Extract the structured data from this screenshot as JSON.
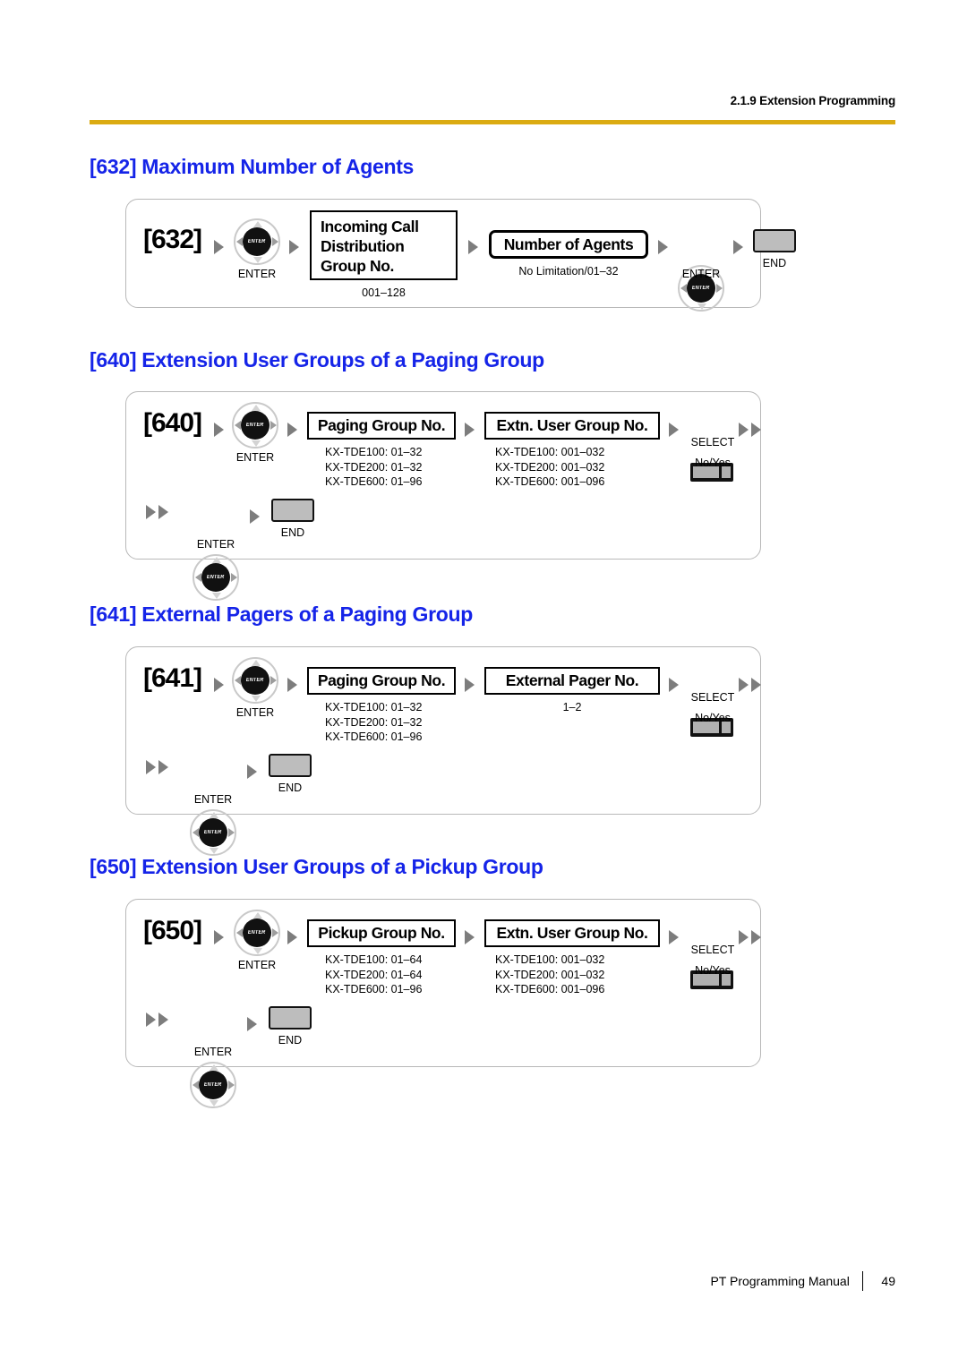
{
  "header": {
    "running_head": "2.1.9 Extension Programming",
    "rule_color": "#dbab12"
  },
  "heading_color": "#1524e8",
  "sections": [
    {
      "heading": "[632] Maximum Number of Agents",
      "prog_code": "[632]",
      "enter_label_1": "ENTER",
      "enter_label_2": "ENTER",
      "box1_line1": "Incoming Call",
      "box1_line2": "Distribution",
      "box1_line3": "Group No.",
      "box1_range": "001–128",
      "box2_label": "Number of Agents",
      "box2_range": "No Limitation/01–32",
      "end_label": "END"
    },
    {
      "heading": "[640] Extension User Groups of a Paging Group",
      "prog_code": "[640]",
      "enter_label_1": "ENTER",
      "enter_label_2": "ENTER",
      "box1_label": "Paging Group No.",
      "box1_range_1": "KX-TDE100: 01–32",
      "box1_range_2": "KX-TDE200: 01–32",
      "box1_range_3": "KX-TDE600: 01–96",
      "box2_label": "Extn. User Group No.",
      "box2_range_1": "KX-TDE100: 001–032",
      "box2_range_2": "KX-TDE200: 001–032",
      "box2_range_3": "KX-TDE600: 001–096",
      "select_label": "SELECT",
      "select_values": "No/Yes",
      "end_label": "END"
    },
    {
      "heading": "[641] External Pagers of a Paging Group",
      "prog_code": "[641]",
      "enter_label_1": "ENTER",
      "enter_label_2": "ENTER",
      "box1_label": "Paging Group No.",
      "box1_range_1": "KX-TDE100: 01–32",
      "box1_range_2": "KX-TDE200: 01–32",
      "box1_range_3": "KX-TDE600: 01–96",
      "box2_label": "External Pager No.",
      "box2_range": "1–2",
      "select_label": "SELECT",
      "select_values": "No/Yes",
      "end_label": "END"
    },
    {
      "heading": "[650] Extension User Groups of a Pickup Group",
      "prog_code": "[650]",
      "enter_label_1": "ENTER",
      "enter_label_2": "ENTER",
      "box1_label": "Pickup Group No.",
      "box1_range_1": "KX-TDE100: 01–64",
      "box1_range_2": "KX-TDE200: 01–64",
      "box1_range_3": "KX-TDE600: 01–96",
      "box2_label": "Extn. User Group No.",
      "box2_range_1": "KX-TDE100: 001–032",
      "box2_range_2": "KX-TDE200: 001–032",
      "box2_range_3": "KX-TDE600: 001–096",
      "select_label": "SELECT",
      "select_values": "No/Yes",
      "end_label": "END"
    }
  ],
  "navkey_glyph_text": "ENTER",
  "footer": {
    "manual_title": "PT Programming Manual",
    "page_number": "49"
  }
}
